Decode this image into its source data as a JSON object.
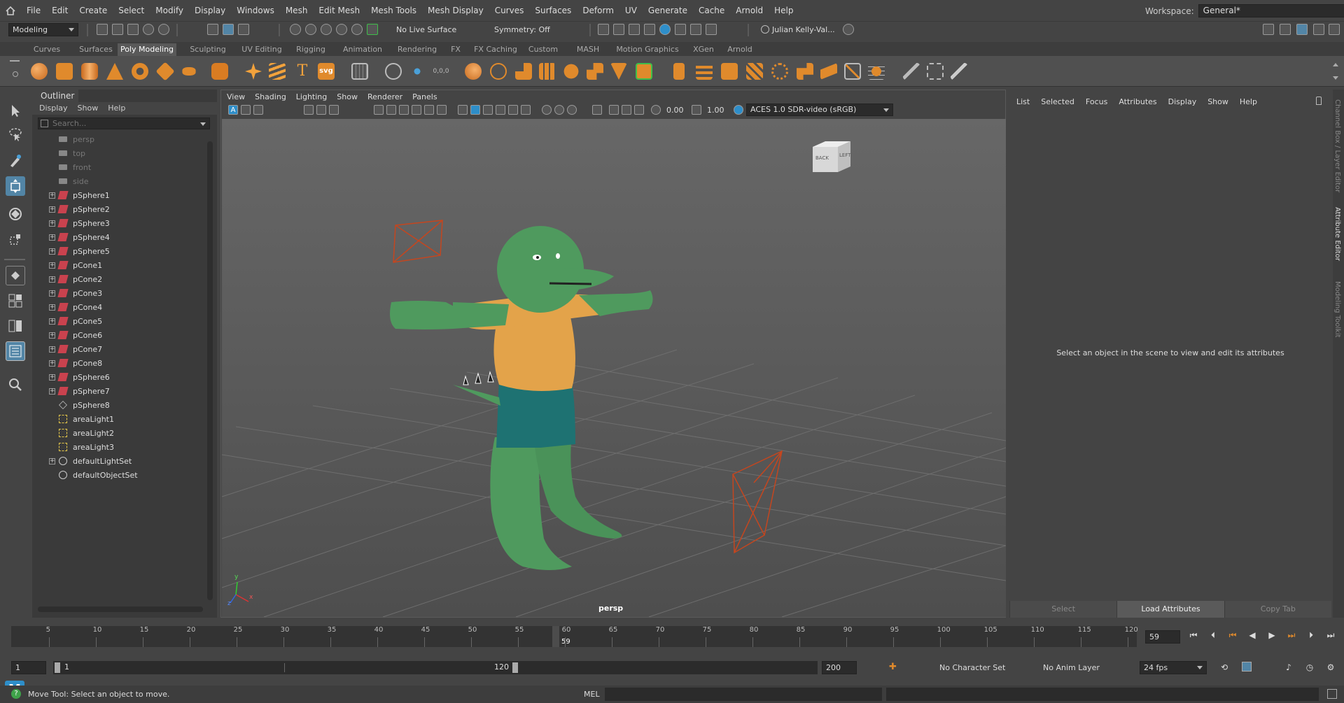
{
  "menu": [
    "File",
    "Edit",
    "Create",
    "Select",
    "Modify",
    "Display",
    "Windows",
    "Mesh",
    "Edit Mesh",
    "Mesh Tools",
    "Mesh Display",
    "Curves",
    "Surfaces",
    "Deform",
    "UV",
    "Generate",
    "Cache",
    "Arnold",
    "Help"
  ],
  "workspace": {
    "label": "Workspace:",
    "value": "General*"
  },
  "status": {
    "mode": "Modeling",
    "live_surface": "No Live Surface",
    "symmetry": "Symmetry: Off",
    "user": "Julian Kelly-Val..."
  },
  "shelf_tabs": [
    "Curves",
    "Surfaces",
    "Poly Modeling",
    "Sculpting",
    "UV Editing",
    "Rigging",
    "Animation",
    "Rendering",
    "FX",
    "FX Caching",
    "Custom",
    "MASH",
    "Motion Graphics",
    "XGen",
    "Arnold"
  ],
  "shelf_active": "Poly Modeling",
  "shelf_icon_labels": {
    "text": "T",
    "svg": "svg",
    "count": "0,0,0"
  },
  "outliner": {
    "title": "Outliner",
    "menus": [
      "Display",
      "Show",
      "Help"
    ],
    "search_placeholder": "Search...",
    "items": [
      {
        "name": "persp",
        "type": "camera",
        "dim": true,
        "expand": false
      },
      {
        "name": "top",
        "type": "camera",
        "dim": true,
        "expand": false
      },
      {
        "name": "front",
        "type": "camera",
        "dim": true,
        "expand": false
      },
      {
        "name": "side",
        "type": "camera",
        "dim": true,
        "expand": false
      },
      {
        "name": "pSphere1",
        "type": "mesh",
        "expand": true
      },
      {
        "name": "pSphere2",
        "type": "mesh",
        "expand": true
      },
      {
        "name": "pSphere3",
        "type": "mesh",
        "expand": true
      },
      {
        "name": "pSphere4",
        "type": "mesh",
        "expand": true
      },
      {
        "name": "pSphere5",
        "type": "mesh",
        "expand": true
      },
      {
        "name": "pCone1",
        "type": "mesh",
        "expand": true
      },
      {
        "name": "pCone2",
        "type": "mesh",
        "expand": true
      },
      {
        "name": "pCone3",
        "type": "mesh",
        "expand": true
      },
      {
        "name": "pCone4",
        "type": "mesh",
        "expand": true
      },
      {
        "name": "pCone5",
        "type": "mesh",
        "expand": true
      },
      {
        "name": "pCone6",
        "type": "mesh",
        "expand": true
      },
      {
        "name": "pCone7",
        "type": "mesh",
        "expand": true
      },
      {
        "name": "pCone8",
        "type": "mesh",
        "expand": true
      },
      {
        "name": "pSphere6",
        "type": "mesh",
        "expand": true
      },
      {
        "name": "pSphere7",
        "type": "mesh",
        "expand": true
      },
      {
        "name": "pSphere8",
        "type": "group",
        "expand": false
      },
      {
        "name": "areaLight1",
        "type": "light",
        "expand": false
      },
      {
        "name": "areaLight2",
        "type": "light",
        "expand": false
      },
      {
        "name": "areaLight3",
        "type": "light",
        "expand": false
      },
      {
        "name": "defaultLightSet",
        "type": "set",
        "expand": true
      },
      {
        "name": "defaultObjectSet",
        "type": "set",
        "expand": false
      }
    ]
  },
  "viewport": {
    "menus": [
      "View",
      "Shading",
      "Lighting",
      "Show",
      "Renderer",
      "Panels"
    ],
    "exposure": "0.00",
    "gamma": "1.00",
    "color_space": "ACES 1.0 SDR-video (sRGB)",
    "camera": "persp",
    "cube_labels": {
      "back": "BACK",
      "left": "LEFT"
    },
    "axis": {
      "x": "x",
      "y": "y",
      "z": "z"
    },
    "icon_text": {
      "a": "A"
    }
  },
  "attribute_editor": {
    "menus": [
      "List",
      "Selected",
      "Focus",
      "Attributes",
      "Display",
      "Show",
      "Help"
    ],
    "hint": "Select an object in the scene to view and edit its attributes",
    "buttons": [
      "Select",
      "Load Attributes",
      "Copy Tab"
    ]
  },
  "side_tabs": [
    "Channel Box / Layer Editor",
    "Attribute Editor",
    "Modeling Toolkit"
  ],
  "timeline": {
    "ticks": [
      "5",
      "10",
      "15",
      "20",
      "25",
      "30",
      "35",
      "40",
      "45",
      "50",
      "55",
      "60",
      "65",
      "70",
      "75",
      "80",
      "85",
      "90",
      "95",
      "100",
      "105",
      "110",
      "115",
      "120"
    ],
    "current": "59",
    "frame_field": "59"
  },
  "range": {
    "start": "1",
    "range_start": "1",
    "range_end": "120",
    "end": "200",
    "character_set": "No Character Set",
    "anim_layer": "No Anim Layer",
    "fps": "24 fps"
  },
  "command": {
    "help": "Move Tool: Select an object to move.",
    "lang": "MEL"
  },
  "colors": {
    "accent": "#5285a6",
    "skin": "#4f9a5e",
    "shirt": "#e3a34a",
    "shorts": "#1e7272",
    "light": "#c4461f"
  }
}
